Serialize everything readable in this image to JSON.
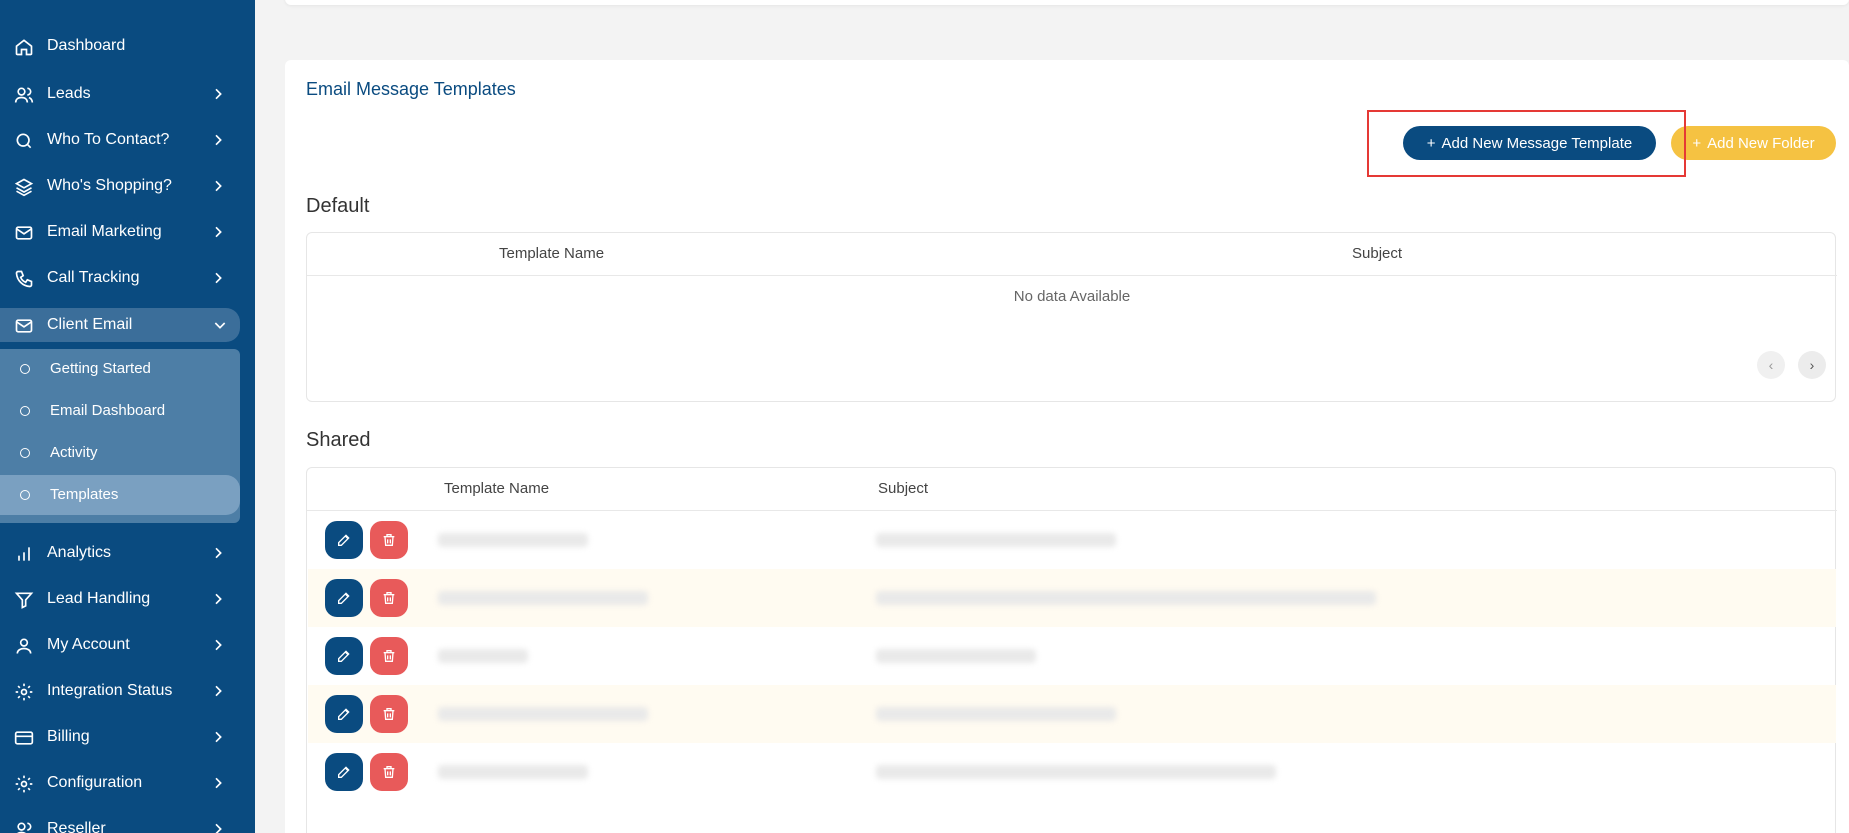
{
  "sidebar": {
    "items": [
      {
        "label": "Dashboard",
        "icon": "home-icon"
      },
      {
        "label": "Leads",
        "icon": "users-icon"
      },
      {
        "label": "Who To Contact?",
        "icon": "search-icon"
      },
      {
        "label": "Who's Shopping?",
        "icon": "layers-icon"
      },
      {
        "label": "Email Marketing",
        "icon": "mail-icon"
      },
      {
        "label": "Call Tracking",
        "icon": "phone-icon"
      },
      {
        "label": "Client Email",
        "icon": "mail-icon"
      },
      {
        "label": "Analytics",
        "icon": "bar-chart-icon"
      },
      {
        "label": "Lead Handling",
        "icon": "filter-icon"
      },
      {
        "label": "My Account",
        "icon": "user-icon"
      },
      {
        "label": "Integration Status",
        "icon": "gear-icon"
      },
      {
        "label": "Billing",
        "icon": "credit-card-icon"
      },
      {
        "label": "Configuration",
        "icon": "gear-icon"
      },
      {
        "label": "Reseller",
        "icon": "users-icon"
      }
    ],
    "submenu": [
      {
        "label": "Getting Started"
      },
      {
        "label": "Email Dashboard"
      },
      {
        "label": "Activity"
      },
      {
        "label": "Templates"
      }
    ]
  },
  "main": {
    "title": "Email Message Templates",
    "add_template_label": "Add New Message Template",
    "add_folder_label": "Add New Folder",
    "default_section": {
      "title": "Default",
      "columns": [
        "Template Name",
        "Subject"
      ],
      "empty_text": "No data Available"
    },
    "shared_section": {
      "title": "Shared",
      "columns": [
        "Template Name",
        "Subject"
      ]
    }
  },
  "colors": {
    "sidebar_bg": "#0a4b80",
    "primary": "#0a4b80",
    "folder_btn": "#f5c242",
    "delete_btn": "#e85a5a",
    "highlight": "#e53935"
  }
}
